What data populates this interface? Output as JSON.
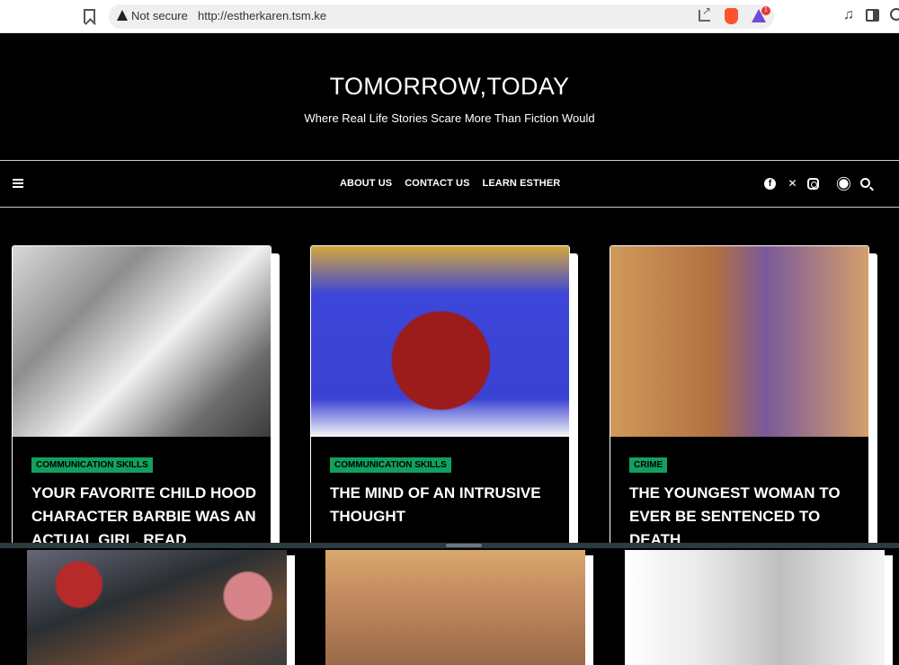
{
  "browser": {
    "security_label": "Not secure",
    "url": "http://estherkaren.tsm.ke",
    "rewards_badge": "1"
  },
  "site": {
    "title": "TOMORROW,TODAY",
    "tagline": "Where Real Life Stories Scare More Than Fiction Would"
  },
  "nav": {
    "links": [
      "ABOUT US",
      "CONTACT US",
      "LEARN ESTHER"
    ]
  },
  "social_icons": [
    "facebook-icon",
    "x-icon",
    "instagram-icon",
    "theme-toggle-icon",
    "search-icon"
  ],
  "posts": [
    {
      "category": "COMMUNICATION SKILLS",
      "title": "YOUR FAVORITE CHILD HOOD CHARACTER BARBIE WAS AN ACTUAL GIRL. READ"
    },
    {
      "category": "COMMUNICATION SKILLS",
      "title": "THE MIND OF AN INTRUSIVE THOUGHT"
    },
    {
      "category": "CRIME",
      "title": "THE YOUNGEST WOMAN TO EVER BE SENTENCED TO DEATH"
    }
  ],
  "colors": {
    "badge": "#12a05e",
    "background": "#000000"
  }
}
